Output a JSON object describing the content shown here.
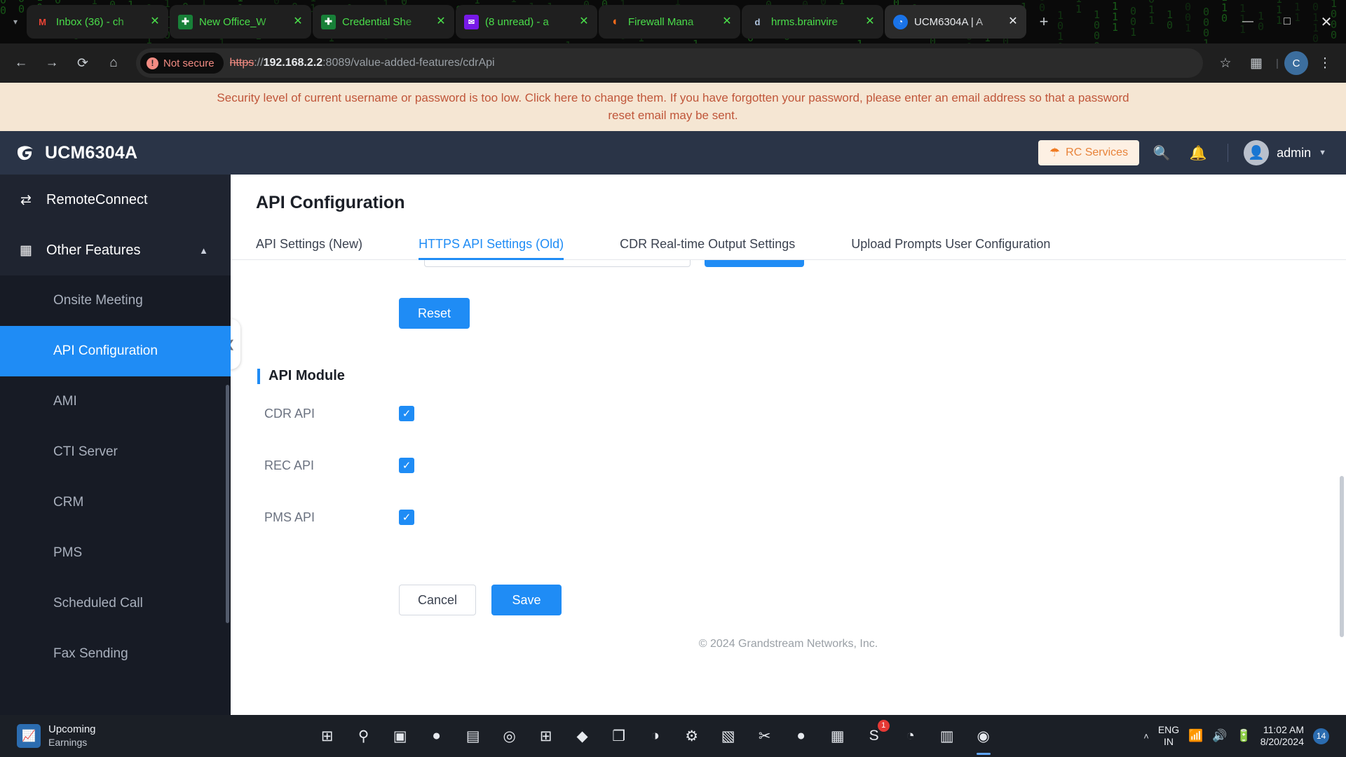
{
  "browser": {
    "tab_list_icon": "chevron-down-icon",
    "new_tab_label": "+",
    "tabs": [
      {
        "title": "Inbox (36) - ch",
        "favicon": "gmail-icon",
        "glyph": "M",
        "active": false
      },
      {
        "title": "New Office_W",
        "favicon": "sheets-icon",
        "glyph": "✚",
        "active": false
      },
      {
        "title": "Credential She",
        "favicon": "sheets-icon",
        "glyph": "✚",
        "active": false
      },
      {
        "title": "(8 unread) - a",
        "favicon": "mail-icon",
        "glyph": "✉",
        "active": false
      },
      {
        "title": "Firewall Mana",
        "favicon": "firewall-icon",
        "glyph": "◖",
        "active": false
      },
      {
        "title": "hrms.brainvire",
        "favicon": "document-icon",
        "glyph": "὜d",
        "active": false
      },
      {
        "title": "UCM6304A | A",
        "favicon": "ucm-icon",
        "glyph": "◔",
        "active": true
      }
    ],
    "nav": {
      "back": "back-arrow-icon",
      "forward": "forward-arrow-icon",
      "reload": "reload-icon",
      "home": "home-icon",
      "bookmark": "star-icon",
      "extensions": "extensions-icon",
      "profile": "C",
      "menu": "three-dot-menu-icon"
    },
    "omnibox": {
      "security_label": "Not secure",
      "security_icon": "not-secure-icon",
      "url_scheme": "https",
      "url_separator": "://",
      "url_host": "192.168.2.2",
      "url_port": ":8089",
      "url_path": "/value-added-features/cdrApi"
    },
    "window_controls": {
      "minimize": "—",
      "maximize": "□",
      "close": "✕"
    }
  },
  "warning_banner": {
    "text": "Security level of current username or password is too low. Click here to change them. If you have forgotten your password, please enter an email address so that a password reset email may be sent."
  },
  "app_header": {
    "logo_icon": "grandstream-logo-icon",
    "product": "UCM6304A",
    "rc_services_label": "RC Services",
    "rc_services_icon": "shield-icon",
    "search_icon": "search-icon",
    "notification_icon": "bell-icon",
    "avatar_icon": "user-avatar-icon",
    "user_name": "admin",
    "caret_icon": "chevron-down-icon"
  },
  "sidebar": {
    "items": [
      {
        "label": "RemoteConnect",
        "icon": "remote-connect-icon",
        "type": "group",
        "active": false
      },
      {
        "label": "Other Features",
        "icon": "grid-icon",
        "type": "group",
        "active": false,
        "caret": "chevron-up-icon"
      },
      {
        "label": "Onsite Meeting",
        "icon": "",
        "type": "sub",
        "active": false
      },
      {
        "label": "API Configuration",
        "icon": "",
        "type": "sub",
        "active": true
      },
      {
        "label": "AMI",
        "icon": "",
        "type": "sub",
        "active": false
      },
      {
        "label": "CTI Server",
        "icon": "",
        "type": "sub",
        "active": false
      },
      {
        "label": "CRM",
        "icon": "",
        "type": "sub",
        "active": false
      },
      {
        "label": "PMS",
        "icon": "",
        "type": "sub",
        "active": false
      },
      {
        "label": "Scheduled Call",
        "icon": "",
        "type": "sub",
        "active": false
      },
      {
        "label": "Fax Sending",
        "icon": "",
        "type": "sub",
        "active": false
      }
    ],
    "collapse_icon": "chevron-left-icon"
  },
  "main": {
    "title": "API Configuration",
    "tabs": [
      {
        "label": "API Settings (New)",
        "active": false
      },
      {
        "label": "HTTPS API Settings (Old)",
        "active": true
      },
      {
        "label": "CDR Real-time Output Settings",
        "active": false
      },
      {
        "label": "Upload Prompts User Configuration",
        "active": false
      }
    ],
    "reset_label": "Reset",
    "section": {
      "title": "API Module",
      "rows": [
        {
          "label": "CDR API",
          "checked": true
        },
        {
          "label": "REC API",
          "checked": true
        },
        {
          "label": "PMS API",
          "checked": true
        }
      ]
    },
    "cancel_label": "Cancel",
    "save_label": "Save",
    "checkmark": "✓",
    "footer": "© 2024 Grandstream Networks, Inc."
  },
  "taskbar": {
    "widget": {
      "icon": "chart-icon",
      "line1": "Upcoming",
      "line2": "Earnings"
    },
    "icons": [
      {
        "name": "start-icon",
        "glyph": "⊞",
        "badge": "",
        "active": false
      },
      {
        "name": "search-icon",
        "glyph": "⚲",
        "badge": "",
        "active": false
      },
      {
        "name": "task-view-icon",
        "glyph": "▣",
        "badge": "",
        "active": false
      },
      {
        "name": "teams-chat-icon",
        "glyph": "●",
        "badge": "",
        "active": false
      },
      {
        "name": "file-explorer-icon",
        "glyph": "▤",
        "badge": "",
        "active": false
      },
      {
        "name": "edge-icon",
        "glyph": "◎",
        "badge": "",
        "active": false
      },
      {
        "name": "store-icon",
        "glyph": "⊞",
        "badge": "",
        "active": false
      },
      {
        "name": "vscode-insiders-icon",
        "glyph": "◆",
        "badge": "",
        "active": false
      },
      {
        "name": "screenshot-tool-icon",
        "glyph": "❐",
        "badge": "",
        "active": false
      },
      {
        "name": "bitwarden-icon",
        "glyph": "◑",
        "badge": "",
        "active": false
      },
      {
        "name": "settings-icon",
        "glyph": "⚙",
        "badge": "",
        "active": false
      },
      {
        "name": "notes-icon",
        "glyph": "▧",
        "badge": "",
        "active": false
      },
      {
        "name": "snipping-tool-icon",
        "glyph": "✂",
        "badge": "",
        "active": false
      },
      {
        "name": "firefox-icon",
        "glyph": "●",
        "badge": "",
        "active": false
      },
      {
        "name": "teams-icon",
        "glyph": "▦",
        "badge": "",
        "active": false
      },
      {
        "name": "skype-icon",
        "glyph": "S",
        "badge": "1",
        "active": false
      },
      {
        "name": "grandstream-wave-icon",
        "glyph": "◔",
        "badge": "",
        "active": false
      },
      {
        "name": "calculator-icon",
        "glyph": "▥",
        "badge": "",
        "active": false
      },
      {
        "name": "chrome-icon",
        "glyph": "◉",
        "badge": "",
        "active": true
      }
    ],
    "tray": {
      "chevron": "˄",
      "lang_line1": "ENG",
      "lang_line2": "IN",
      "wifi_icon": "wifi-icon",
      "volume_icon": "volume-icon",
      "battery_icon": "battery-icon",
      "time": "11:02 AM",
      "date": "8/20/2024",
      "notification_count": "14"
    }
  }
}
